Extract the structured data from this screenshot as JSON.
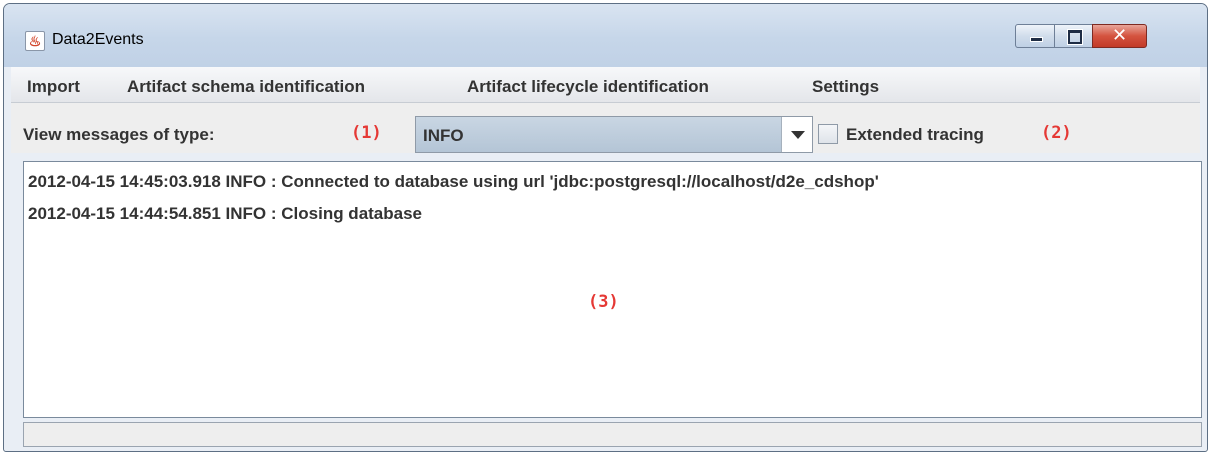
{
  "window": {
    "title": "Data2Events",
    "app_icon": "java-coffee-icon",
    "controls": {
      "minimize": "minimize-icon",
      "maximize": "maximize-icon",
      "close_glyph": "✕"
    }
  },
  "menu": {
    "items": [
      "Import",
      "Artifact schema identification",
      "Artifact lifecycle identification",
      "Settings"
    ]
  },
  "toolbar": {
    "view_label": "View messages of type:",
    "selected_type": "INFO",
    "extended_tracing_label": "Extended tracing",
    "extended_tracing_checked": false
  },
  "annotations": [
    "(1)",
    "(2)",
    "(3)"
  ],
  "log": {
    "lines": [
      "2012-04-15 14:45:03.918 INFO : Connected to database using url 'jdbc:postgresql://localhost/d2e_cdshop'",
      "2012-04-15 14:44:54.851 INFO : Closing database"
    ]
  },
  "status": {
    "text": ""
  },
  "colors": {
    "annotation": "#e53935",
    "titlebar": "#c6d6e9",
    "combo": "#b9c9da",
    "close_button": "#c9442f"
  }
}
